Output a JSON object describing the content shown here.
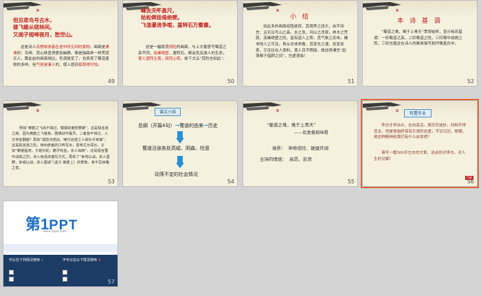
{
  "slides": [
    {
      "num": "49",
      "poem": [
        "但见悲鸟号古木，",
        "雄飞雌从绕林间。",
        "又闻子规啼夜月，愁空山。"
      ],
      "body_pre": "这是诗人",
      "body_red1": "设想旅游者在途中所见到的景物",
      "body_mid": "。画面是",
      "body_red2": "凄清",
      "body_rest": "的：鸟啼、悲山林显得更加幽静，像是独森林一样荒寂无人，跟此前的画面相比，色调是变了，也表现了蜀道景物的多样。但",
      "body_red3": "气氛是凄人",
      "body_end": "的，使人感到",
      "body_red4": "孤寂得可怕",
      "body_tail": "。"
    },
    {
      "num": "50",
      "poem": [
        "峰去天不盈尺，",
        "枯松倒挂倚绝壁。",
        "飞湍瀑流争喧，崖转石万壑雷。"
      ],
      "body_pre": "这是一幅极其",
      "body_red1": "惊险",
      "body_mid": "的画面，与上文着意写蜀道之高不同，",
      "body_red2": "这峰绝壁",
      "body_rest": "，崖转石，都会危及游人的生命，",
      "body_red3": "使人望而生畏，闻而心惊",
      "body_end": "，故下文云“其险也如此”。"
    },
    {
      "num": "51",
      "title": "小  结",
      "body": "如此多的画面经隐彼现，其境界之阔大，自不待言；且无论写山之高，水之急，河山之改观，林木之荒寂，连峰绝壁之险，皆有逼人之势。其气象之宏伟，确非他人之可及，再从总体来看，其变化之速，愈变愈奇，又往往在人意料，使人目不暇接，故这得谓言“起落都于指顾之间”，岂虚语哉！"
    },
    {
      "num": "52",
      "title": "本 诗 基 调",
      "body": "“蜀道之难，难于上青天”贯穿始终，显示咏叹基调：一叹蜀道之高，二叹蜀道之险，三叹蜀中战祸之烈，三叹也蕴含在诗人的具体描写和抒情直白中。"
    },
    {
      "num": "53",
      "body": "例如“黄鹤之飞尚不得过，猿猱欲度愁攀援”，这是极言道之高，因为黄鹤之飞甚高，猿猱动作最灵，二者皆不得过，人又何言翻越？再如“其险也若此，嗟尔远道之人胡为乎来哉”，这是极言道之险，用劝旅者的口吻写出，意味尤为深长。又如“朝避猛虎，夕避长蛇，磨牙吮血，杀人如麻”，这是极言蜀中战祸之烈，诗人用具体描写方式，再现了“争地以战，杀人盈野，争城以战，杀人盈城”（孟子 离娄上）的景象，有不忍目睹之意。"
    },
    {
      "num": "54",
      "tag": "课文小结",
      "row1_left": "总纲（开篇4句）",
      "row1_mid": "蜀道的由来",
      "row1_right": "历史",
      "row2": "蜀道沿途各处高峻、阴森、险恶",
      "row3": "动荡不定的社会情况"
    },
    {
      "num": "55",
      "quote": "“蜀道之难，难于上青天”",
      "quote_sub": "——反复叠现咏唱",
      "line1_label": "境界：",
      "line1_text": "神奇惊险、雄健开阔",
      "line2_label": "全诗的情感：",
      "line2_text": "高昂、澎湃"
    },
    {
      "num": "56",
      "tag": "布置作业",
      "body": "李白才学出众，志向高远，虽历尽波折，仰制不得其志，但是他始终保有乐观的态度，不甘沉沦。根据，他这种精神给我们有什么启发呢？",
      "body2": "请写一篇300字左右的文章，谈谈你对李白，对人生的见解！",
      "badge": "目录"
    },
    {
      "num": "57",
      "logo_num": "第1",
      "logo_ppt": "PPT",
      "logo_url": "www.1ppt.com",
      "col1_title": "可以在下列情况使用",
      "col2_title": "不可以在以下情况使用"
    }
  ]
}
